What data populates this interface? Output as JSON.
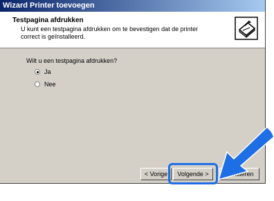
{
  "window": {
    "title": "Wizard Printer toevoegen"
  },
  "header": {
    "title": "Testpagina afdrukken",
    "description": "U kunt een testpagina afdrukken om te bevestigen dat de printer correct is geïnstalleerd.",
    "icon": "printer-check-icon"
  },
  "main": {
    "question": "Wilt u een testpagina afdrukken?",
    "options": [
      {
        "label": "Ja",
        "selected": true
      },
      {
        "label": "Nee",
        "selected": false
      }
    ]
  },
  "buttons": {
    "back": "< Vorige",
    "next": "Volgende >",
    "cancel": "Annuleren"
  },
  "annotation": {
    "arrow_color": "#1e6ee6",
    "arrow_icon": "pointer-arrow-icon"
  }
}
